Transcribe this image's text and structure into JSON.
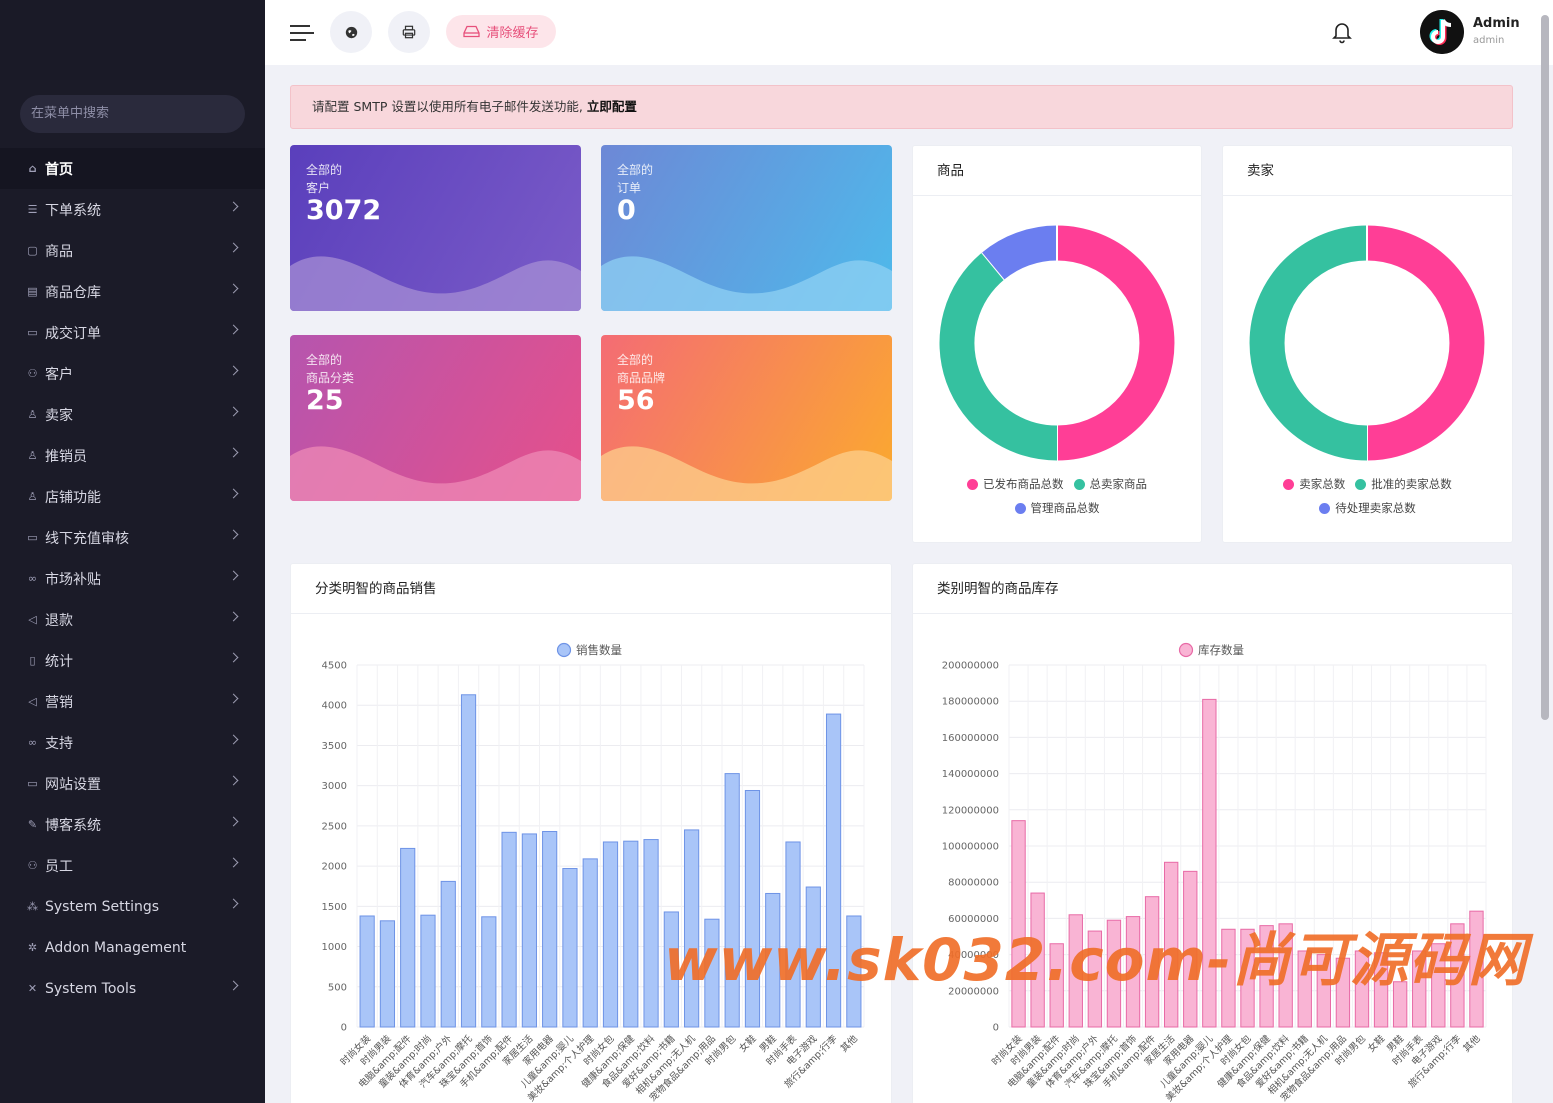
{
  "search": {
    "placeholder": "在菜单中搜索"
  },
  "menu": [
    {
      "label": "首页",
      "icon": "home-icon",
      "active": true,
      "chevron": false
    },
    {
      "label": "下单系统",
      "icon": "list-icon",
      "chevron": true
    },
    {
      "label": "商品",
      "icon": "bag-icon",
      "chevron": true
    },
    {
      "label": "商品仓库",
      "icon": "warehouse-icon",
      "chevron": true
    },
    {
      "label": "成交订单",
      "icon": "money-icon",
      "chevron": true
    },
    {
      "label": "客户",
      "icon": "users-icon",
      "chevron": true
    },
    {
      "label": "卖家",
      "icon": "user-icon",
      "chevron": true
    },
    {
      "label": "推销员",
      "icon": "user-icon",
      "chevron": true
    },
    {
      "label": "店铺功能",
      "icon": "user-icon",
      "chevron": true
    },
    {
      "label": "线下充值审核",
      "icon": "money-icon",
      "chevron": true
    },
    {
      "label": "市场补贴",
      "icon": "link-icon",
      "chevron": true
    },
    {
      "label": "退款",
      "icon": "backward-icon",
      "chevron": true
    },
    {
      "label": "统计",
      "icon": "file-icon",
      "chevron": true
    },
    {
      "label": "营销",
      "icon": "megaphone-icon",
      "chevron": true
    },
    {
      "label": "支持",
      "icon": "link-icon",
      "chevron": true
    },
    {
      "label": "网站设置",
      "icon": "monitor-icon",
      "chevron": true
    },
    {
      "label": "博客系统",
      "icon": "blog-icon",
      "chevron": true
    },
    {
      "label": "员工",
      "icon": "staff-icon",
      "chevron": true
    },
    {
      "label": "System Settings",
      "icon": "share-icon",
      "chevron": true
    },
    {
      "label": "Addon Management",
      "icon": "addon-icon",
      "chevron": false
    },
    {
      "label": "System Tools",
      "icon": "tools-icon",
      "chevron": true
    }
  ],
  "header": {
    "clear_cache": "清除缓存",
    "user_name": "Admin",
    "user_role": "admin"
  },
  "alert": {
    "text": "请配置 SMTP 设置以使用所有电子邮件发送功能,",
    "link": "立即配置"
  },
  "stats": [
    {
      "label1": "全部的",
      "label2": "客户",
      "value": "3072",
      "from": "#5a3fbc",
      "to": "#7b5cc8",
      "wave": "#a58ed4"
    },
    {
      "label1": "全部的",
      "label2": "订单",
      "value": "0",
      "from": "#6d88d6",
      "to": "#4ebaeb",
      "wave": "#8fd0f3"
    },
    {
      "label1": "全部的",
      "label2": "商品分类",
      "value": "25",
      "from": "#b655ae",
      "to": "#e6508a",
      "wave": "#ee8ab5"
    },
    {
      "label1": "全部的",
      "label2": "商品品牌",
      "value": "56",
      "from": "#f46c74",
      "to": "#fbaa2e",
      "wave": "#fccf8c"
    }
  ],
  "donut_products": {
    "title": "商品",
    "segments": [
      {
        "label": "已发布商品总数",
        "value": 50,
        "color": "#ff3e96"
      },
      {
        "label": "总卖家商品",
        "value": 39,
        "color": "#35c1a0"
      },
      {
        "label": "管理商品总数",
        "value": 11,
        "color": "#6b7ef0"
      }
    ]
  },
  "donut_sellers": {
    "title": "卖家",
    "segments": [
      {
        "label": "卖家总数",
        "value": 50,
        "color": "#ff3e96"
      },
      {
        "label": "批准的卖家总数",
        "value": 50,
        "color": "#35c1a0"
      },
      {
        "label": "待处理卖家总数",
        "value": 0,
        "color": "#6b7ef0"
      }
    ]
  },
  "sales_panel": {
    "title": "分类明智的商品销售"
  },
  "stock_panel": {
    "title": "类别明智的商品库存"
  },
  "chart_data": [
    {
      "type": "bar",
      "series": [
        {
          "name": "销售数量",
          "color": "#a9c5f8",
          "stroke": "#6e93e6",
          "values": [
            1380,
            1320,
            2220,
            1390,
            1810,
            4130,
            1370,
            2420,
            2400,
            2430,
            1970,
            2090,
            2300,
            2310,
            2330,
            1430,
            2450,
            1340,
            3150,
            2940,
            1660,
            2300,
            1740,
            3890,
            1380
          ]
        }
      ],
      "categories": [
        "时尚女装",
        "时尚男装",
        "电脑&amp;配件",
        "童装&amp;时尚",
        "体育&amp;户外",
        "汽车&amp;摩托",
        "珠宝&amp;首饰",
        "手机&amp;配件",
        "家居生活",
        "家用电器",
        "儿童&amp;婴儿",
        "美妆&amp;个人护理",
        "时尚女包",
        "健康&amp;保健",
        "食品&amp;饮料",
        "爱好&amp;书籍",
        "相机&amp;无人机",
        "宠物食品&amp;用品",
        "时尚男包",
        "女鞋",
        "男鞋",
        "时尚手表",
        "电子游戏",
        "旅行&amp;行李",
        "其他"
      ],
      "yticks": [
        0,
        500,
        1000,
        1500,
        2000,
        2500,
        3000,
        3500,
        4000,
        4500
      ],
      "ylim": [
        0,
        4500
      ],
      "grid": true,
      "legend": "top-center"
    },
    {
      "type": "bar",
      "series": [
        {
          "name": "库存数量",
          "color": "#f9b4d4",
          "stroke": "#e86aa6",
          "values": [
            114000000,
            74000000,
            46000000,
            62000000,
            53000000,
            59000000,
            61000000,
            72000000,
            91000000,
            86000000,
            181000000,
            54000000,
            54000000,
            56000000,
            57000000,
            42000000,
            40000000,
            38000000,
            42000000,
            41000000,
            25000000,
            42000000,
            46000000,
            57000000,
            64000000
          ]
        }
      ],
      "categories": [
        "时尚女装",
        "时尚男装",
        "电脑&amp;配件",
        "童装&amp;时尚",
        "体育&amp;户外",
        "汽车&amp;摩托",
        "珠宝&amp;首饰",
        "手机&amp;配件",
        "家居生活",
        "家用电器",
        "儿童&amp;婴儿",
        "美妆&amp;个人护理",
        "时尚女包",
        "健康&amp;保健",
        "食品&amp;饮料",
        "爱好&amp;书籍",
        "相机&amp;无人机",
        "宠物食品&amp;用品",
        "时尚男包",
        "女鞋",
        "男鞋",
        "时尚手表",
        "电子游戏",
        "旅行&amp;行李",
        "其他"
      ],
      "yticks": [
        0,
        20000000,
        40000000,
        60000000,
        80000000,
        100000000,
        120000000,
        140000000,
        160000000,
        180000000,
        200000000
      ],
      "ylim": [
        0,
        200000000
      ],
      "grid": true,
      "legend": "top-center"
    }
  ],
  "watermark": "www.sk032.com-尚可源码网"
}
